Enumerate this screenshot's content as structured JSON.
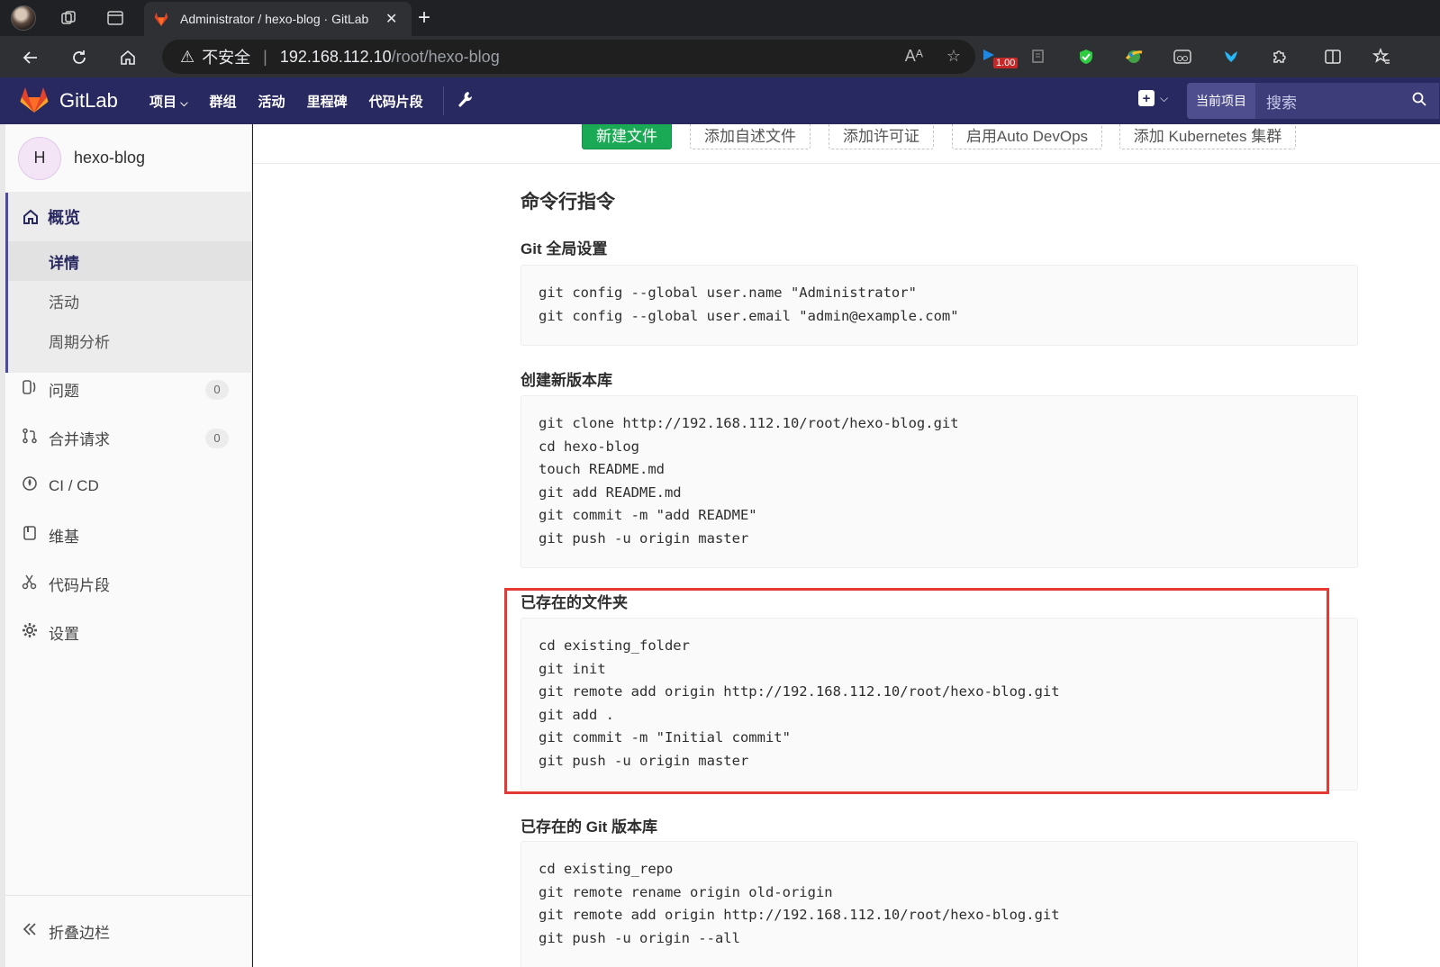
{
  "browser": {
    "tab_title": "Administrator / hexo-blog · GitLab",
    "address_insecure": "不安全",
    "address_host": "192.168.112.10",
    "address_path": "/root/hexo-blog",
    "ext_badge": "1.00"
  },
  "gitlab_header": {
    "brand": "GitLab",
    "nav": [
      "项目",
      "群组",
      "活动",
      "里程碑",
      "代码片段"
    ],
    "search_scope": "当前项目",
    "search_placeholder": "搜索"
  },
  "sidebar": {
    "project_initial": "H",
    "project_name": "hexo-blog",
    "overview_title": "概览",
    "overview_sub": [
      "详情",
      "活动",
      "周期分析"
    ],
    "items": [
      {
        "label": "问题",
        "count": "0"
      },
      {
        "label": "合并请求",
        "count": "0"
      },
      {
        "label": "CI / CD"
      },
      {
        "label": "维基"
      },
      {
        "label": "代码片段"
      },
      {
        "label": "设置"
      }
    ],
    "collapse_label": "折叠边栏"
  },
  "actions": {
    "new_file": "新建文件",
    "add_readme": "添加自述文件",
    "add_license": "添加许可证",
    "enable_devops": "启用Auto DevOps",
    "add_k8s": "添加 Kubernetes 集群"
  },
  "cli": {
    "title": "命令行指令",
    "sections": [
      {
        "heading": "Git 全局设置",
        "code": "git config --global user.name \"Administrator\"\ngit config --global user.email \"admin@example.com\""
      },
      {
        "heading": "创建新版本库",
        "code": "git clone http://192.168.112.10/root/hexo-blog.git\ncd hexo-blog\ntouch README.md\ngit add README.md\ngit commit -m \"add README\"\ngit push -u origin master"
      },
      {
        "heading": "已存在的文件夹",
        "code": "cd existing_folder\ngit init\ngit remote add origin http://192.168.112.10/root/hexo-blog.git\ngit add .\ngit commit -m \"Initial commit\"\ngit push -u origin master"
      },
      {
        "heading": "已存在的 Git 版本库",
        "code": "cd existing_repo\ngit remote rename origin old-origin\ngit remote add origin http://192.168.112.10/root/hexo-blog.git\ngit push -u origin --all"
      }
    ]
  },
  "colors": {
    "gitlab_header": "#292961",
    "green_button": "#1aaa55",
    "highlight": "#e53935"
  }
}
